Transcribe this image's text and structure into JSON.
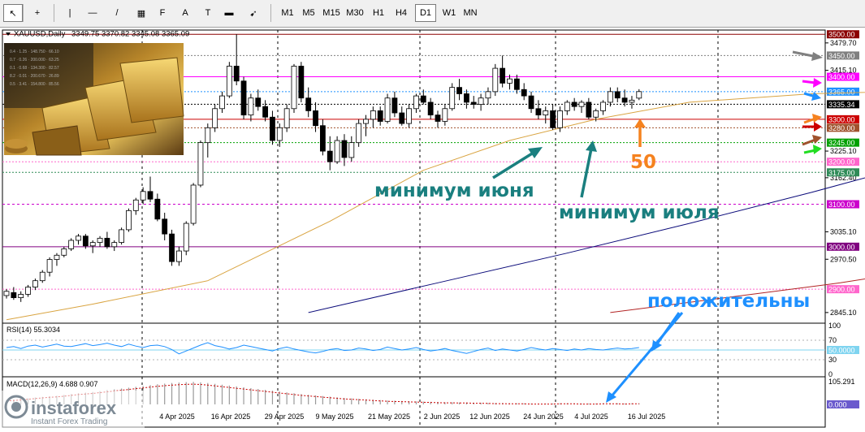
{
  "toolbar": {
    "tools": [
      {
        "name": "cursor-icon",
        "glyph": "↖"
      },
      {
        "name": "crosshair-icon",
        "glyph": "+"
      },
      {
        "name": "vertical-line-icon",
        "glyph": "|"
      },
      {
        "name": "horizontal-line-icon",
        "glyph": "—"
      },
      {
        "name": "trendline-icon",
        "glyph": "/"
      },
      {
        "name": "channel-icon",
        "glyph": "▦"
      },
      {
        "name": "fibonacci-icon",
        "glyph": "F"
      },
      {
        "name": "text-icon",
        "glyph": "A"
      },
      {
        "name": "text-label-icon",
        "glyph": "T"
      },
      {
        "name": "shape-icon",
        "glyph": "▬"
      },
      {
        "name": "arrows-icon",
        "glyph": "➹"
      }
    ],
    "timeframes": [
      "M1",
      "M5",
      "M15",
      "M30",
      "H1",
      "H4",
      "D1",
      "W1",
      "MN"
    ],
    "active_timeframe": "D1"
  },
  "header": {
    "symbol": "XAUUSD,Daily",
    "ohlc": "3349.75 3370.82 3345.08 3365.09"
  },
  "colors": {
    "bull": "#00aa00",
    "bear": "#000000",
    "ma_short": "#d9a441",
    "ma_mid": "#0b0b7a",
    "ma_long": "#b22222",
    "annotation": "#1a7f7f",
    "blue_text": "#1e90ff",
    "orange": "#f5821f"
  },
  "chart_data": {
    "type": "candlestick",
    "symbol": "XAUUSD",
    "timeframe": "Daily",
    "ylim": [
      2820,
      3510
    ],
    "x_labels": [
      "4 Apr 2025",
      "16 Apr 2025",
      "29 Apr 2025",
      "9 May 2025",
      "21 May 2025",
      "2 Jun 2025",
      "12 Jun 2025",
      "24 Jun 2025",
      "4 Jul 2025",
      "16 Jul 2025"
    ],
    "y_ticks": [
      "3479.70",
      "3415.10",
      "3225.10",
      "3162.40",
      "3035.10",
      "2970.50",
      "2845.10"
    ],
    "candles": [
      [
        2885,
        2900,
        2878,
        2895
      ],
      [
        2892,
        2905,
        2875,
        2880
      ],
      [
        2880,
        2895,
        2870,
        2888
      ],
      [
        2888,
        2910,
        2882,
        2905
      ],
      [
        2905,
        2925,
        2898,
        2920
      ],
      [
        2920,
        2945,
        2915,
        2940
      ],
      [
        2940,
        2975,
        2930,
        2970
      ],
      [
        2970,
        2985,
        2955,
        2980
      ],
      [
        2980,
        3000,
        2975,
        2995
      ],
      [
        2995,
        3020,
        2990,
        3015
      ],
      [
        3015,
        3030,
        3005,
        3025
      ],
      [
        3025,
        3030,
        2995,
        3002
      ],
      [
        3002,
        3015,
        2985,
        3010
      ],
      [
        3010,
        3025,
        3000,
        3020
      ],
      [
        3020,
        3035,
        2995,
        3000
      ],
      [
        3000,
        3015,
        2990,
        3010
      ],
      [
        3010,
        3045,
        3005,
        3040
      ],
      [
        3040,
        3090,
        3035,
        3085
      ],
      [
        3085,
        3115,
        3075,
        3110
      ],
      [
        3110,
        3140,
        3100,
        3130
      ],
      [
        3130,
        3165,
        3105,
        3112
      ],
      [
        3112,
        3125,
        3060,
        3065
      ],
      [
        3065,
        3080,
        3015,
        3030
      ],
      [
        3030,
        3040,
        2955,
        2965
      ],
      [
        2965,
        3000,
        2955,
        2990
      ],
      [
        2990,
        3060,
        2980,
        3055
      ],
      [
        3055,
        3150,
        3050,
        3145
      ],
      [
        3145,
        3250,
        3140,
        3245
      ],
      [
        3245,
        3290,
        3210,
        3280
      ],
      [
        3280,
        3335,
        3270,
        3325
      ],
      [
        3325,
        3365,
        3315,
        3355
      ],
      [
        3355,
        3435,
        3350,
        3425
      ],
      [
        3425,
        3500,
        3380,
        3390
      ],
      [
        3390,
        3400,
        3300,
        3310
      ],
      [
        3310,
        3360,
        3295,
        3350
      ],
      [
        3350,
        3370,
        3320,
        3330
      ],
      [
        3330,
        3345,
        3295,
        3305
      ],
      [
        3305,
        3320,
        3240,
        3250
      ],
      [
        3250,
        3290,
        3235,
        3280
      ],
      [
        3280,
        3335,
        3270,
        3325
      ],
      [
        3325,
        3430,
        3315,
        3425
      ],
      [
        3425,
        3435,
        3340,
        3350
      ],
      [
        3350,
        3375,
        3305,
        3320
      ],
      [
        3320,
        3340,
        3270,
        3285
      ],
      [
        3285,
        3300,
        3215,
        3225
      ],
      [
        3225,
        3260,
        3180,
        3200
      ],
      [
        3200,
        3260,
        3195,
        3250
      ],
      [
        3250,
        3265,
        3190,
        3210
      ],
      [
        3210,
        3260,
        3200,
        3245
      ],
      [
        3245,
        3300,
        3235,
        3290
      ],
      [
        3290,
        3310,
        3260,
        3300
      ],
      [
        3300,
        3330,
        3280,
        3320
      ],
      [
        3320,
        3330,
        3285,
        3295
      ],
      [
        3295,
        3360,
        3290,
        3350
      ],
      [
        3350,
        3365,
        3305,
        3315
      ],
      [
        3315,
        3330,
        3285,
        3290
      ],
      [
        3290,
        3335,
        3280,
        3325
      ],
      [
        3325,
        3360,
        3315,
        3355
      ],
      [
        3355,
        3370,
        3335,
        3340
      ],
      [
        3340,
        3350,
        3300,
        3310
      ],
      [
        3310,
        3320,
        3280,
        3295
      ],
      [
        3295,
        3335,
        3285,
        3325
      ],
      [
        3325,
        3385,
        3320,
        3375
      ],
      [
        3375,
        3395,
        3345,
        3360
      ],
      [
        3360,
        3370,
        3325,
        3340
      ],
      [
        3340,
        3355,
        3325,
        3335
      ],
      [
        3335,
        3360,
        3320,
        3350
      ],
      [
        3350,
        3375,
        3335,
        3365
      ],
      [
        3365,
        3430,
        3355,
        3420
      ],
      [
        3420,
        3450,
        3375,
        3385
      ],
      [
        3385,
        3405,
        3370,
        3395
      ],
      [
        3395,
        3405,
        3360,
        3370
      ],
      [
        3370,
        3385,
        3345,
        3355
      ],
      [
        3355,
        3365,
        3315,
        3325
      ],
      [
        3325,
        3345,
        3300,
        3310
      ],
      [
        3310,
        3330,
        3290,
        3320
      ],
      [
        3320,
        3335,
        3275,
        3280
      ],
      [
        3280,
        3330,
        3270,
        3320
      ],
      [
        3320,
        3345,
        3310,
        3340
      ],
      [
        3340,
        3350,
        3320,
        3330
      ],
      [
        3330,
        3345,
        3315,
        3340
      ],
      [
        3340,
        3350,
        3300,
        3305
      ],
      [
        3305,
        3325,
        3295,
        3320
      ],
      [
        3320,
        3345,
        3310,
        3340
      ],
      [
        3340,
        3375,
        3330,
        3365
      ],
      [
        3365,
        3375,
        3340,
        3350
      ],
      [
        3350,
        3370,
        3330,
        3340
      ],
      [
        3340,
        3355,
        3325,
        3345
      ],
      [
        3349.75,
        3370.82,
        3345.08,
        3365.09
      ]
    ],
    "ma_short": [
      [
        0,
        2828
      ],
      [
        12,
        2865
      ],
      [
        28,
        2920
      ],
      [
        45,
        3060
      ],
      [
        58,
        3180
      ],
      [
        70,
        3250
      ],
      [
        82,
        3300
      ],
      [
        95,
        3340
      ],
      [
        112,
        3360
      ],
      [
        130,
        3368
      ]
    ],
    "ma_mid": [
      [
        42,
        2845
      ],
      [
        60,
        2915
      ],
      [
        78,
        2985
      ],
      [
        95,
        3055
      ],
      [
        112,
        3128
      ],
      [
        132,
        3220
      ]
    ],
    "ma_long": [
      [
        84,
        2845
      ],
      [
        100,
        2880
      ],
      [
        116,
        2915
      ],
      [
        131,
        2955
      ]
    ],
    "price_levels": [
      {
        "value": 3500,
        "label": "3500.00",
        "color": "#8b0000",
        "label_bg": "#8b0000",
        "label_fg": "#ffffff",
        "dash": ""
      },
      {
        "value": 3450,
        "label": "3450.00",
        "color": "#808080",
        "label_bg": "#808080",
        "label_fg": "#ffffff",
        "dash": "2,2"
      },
      {
        "value": 3400,
        "label": "3400.00",
        "color": "#ff00ff",
        "label_bg": "#ff00ff",
        "label_fg": "#ffffff",
        "dash": ""
      },
      {
        "value": 3365,
        "label": "3365.00",
        "color": "#1e90ff",
        "label_bg": "#1e90ff",
        "label_fg": "#ffffff",
        "dash": "2,2"
      },
      {
        "value": 3335.34,
        "label": "3335.34",
        "color": "#000000",
        "label_bg": "#000000",
        "label_fg": "#ffffff",
        "dash": "2,2"
      },
      {
        "value": 3300,
        "label": "3300.00",
        "color": "#cc0000",
        "label_bg": "#cc0000",
        "label_fg": "#ffffff",
        "dash": ""
      },
      {
        "value": 3280,
        "label": "3280.00",
        "color": "#a0522d",
        "label_bg": "#a0522d",
        "label_fg": "#ffffff",
        "dash": "2,2"
      },
      {
        "value": 3245,
        "label": "3245.00",
        "color": "#00a000",
        "label_bg": "#00a000",
        "label_fg": "#ffffff",
        "dash": "2,2"
      },
      {
        "value": 3200,
        "label": "3200.00",
        "color": "#ff66cc",
        "label_bg": "#ff66cc",
        "label_fg": "#ffffff",
        "dash": "2,2"
      },
      {
        "value": 3175,
        "label": "3175.00",
        "color": "#2e8b57",
        "label_bg": "#2e8b57",
        "label_fg": "#ffffff",
        "dash": "2,2"
      },
      {
        "value": 3100,
        "label": "3100.00",
        "color": "#cc00cc",
        "label_bg": "#cc00cc",
        "label_fg": "#ffffff",
        "dash": "3,3"
      },
      {
        "value": 3000,
        "label": "3000.00",
        "color": "#800080",
        "label_bg": "#800080",
        "label_fg": "#ffffff",
        "dash": ""
      },
      {
        "value": 2900,
        "label": "2900.00",
        "color": "#ff66cc",
        "label_bg": "#ff66cc",
        "label_fg": "#ffffff",
        "dash": "2,2"
      }
    ],
    "annotations": [
      {
        "text": "минимум июня",
        "color": "#1a7f7f"
      },
      {
        "text": "минимум июля",
        "color": "#1a7f7f"
      },
      {
        "text": "положительны",
        "color": "#1e90ff"
      },
      {
        "text": "50",
        "color": "#f5821f"
      }
    ],
    "rsi": {
      "label": "RSI(14) 55.3034",
      "ylim": [
        0,
        100
      ],
      "ticks": [
        "100",
        "70",
        "30",
        "0"
      ],
      "level_label": "50.0000",
      "values": [
        55,
        57,
        53,
        58,
        60,
        56,
        59,
        62,
        58,
        57,
        60,
        63,
        59,
        61,
        64,
        60,
        57,
        62,
        58,
        55,
        59,
        60,
        57,
        51,
        42,
        48,
        54,
        60,
        65,
        59,
        56,
        52,
        55,
        60,
        57,
        54,
        51,
        48,
        53,
        56,
        52,
        49,
        46,
        44,
        47,
        51,
        53,
        49,
        50,
        54,
        52,
        49,
        51,
        56,
        53,
        50,
        52,
        55,
        51,
        48,
        50,
        53,
        49,
        46,
        43,
        47,
        51,
        54,
        49,
        52,
        50,
        48,
        51,
        55,
        52,
        50,
        53,
        51,
        49,
        52,
        50,
        53,
        51,
        50,
        52,
        54,
        52,
        53,
        55
      ]
    },
    "macd": {
      "label": "MACD(12,26,9) 4.688 0.907",
      "ticks": [
        "105.291"
      ],
      "level_label": "0.000",
      "ylim": [
        0,
        110
      ],
      "hist": [
        20,
        22,
        25,
        28,
        32,
        35,
        38,
        40,
        44,
        48,
        52,
        55,
        58,
        62,
        66,
        70,
        74,
        78,
        82,
        86,
        90,
        94,
        97,
        100,
        102,
        104,
        105,
        103,
        100,
        96,
        92,
        88,
        84,
        80,
        76,
        72,
        68,
        64,
        60,
        56,
        52,
        48,
        45,
        42,
        39,
        36,
        33,
        30,
        28,
        26,
        24,
        22,
        20,
        18,
        17,
        16,
        15,
        14,
        13,
        12,
        11,
        10,
        10,
        9,
        9,
        8,
        8,
        7,
        6,
        6,
        5,
        5,
        5,
        4,
        4,
        4,
        4,
        5,
        5,
        5,
        4,
        4,
        4,
        5,
        5,
        5,
        4,
        5,
        5
      ]
    },
    "logo": {
      "brand": "instaforex",
      "tagline": "Instant Forex Trading"
    }
  }
}
